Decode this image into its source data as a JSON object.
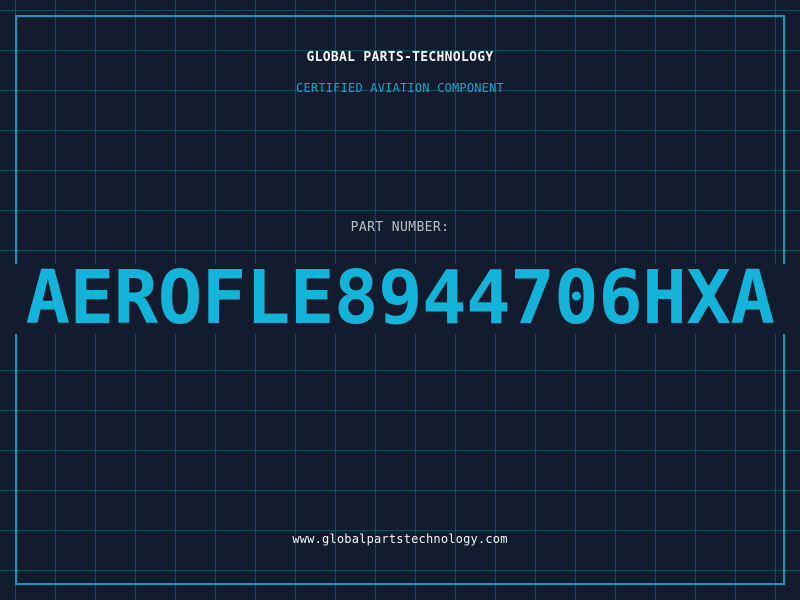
{
  "company_name": "GLOBAL PARTS-TECHNOLOGY",
  "subtitle": "CERTIFIED AVIATION COMPONENT",
  "part_label": "PART NUMBER:",
  "part_number": "AEROFLE8944706HXA",
  "website": "www.globalpartstechnology.com",
  "colors": {
    "background": "#131c2e",
    "grid": "#146e8c",
    "border": "#1597c4",
    "accent": "#14b3da",
    "text": "#f3f5f7",
    "muted": "#b9c0c9"
  }
}
